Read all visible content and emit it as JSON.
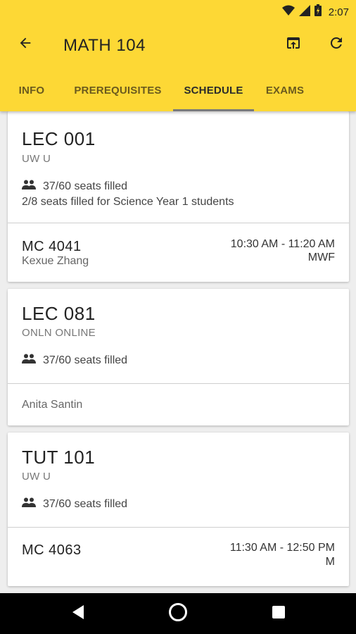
{
  "status_bar": {
    "time": "2:07",
    "icons": [
      "wifi-icon",
      "signal-icon",
      "battery-icon"
    ]
  },
  "toolbar": {
    "title": "MATH 104",
    "back_icon": "arrow-back-icon",
    "actions": [
      "open-in-browser-icon",
      "refresh-icon"
    ]
  },
  "tabs": [
    {
      "label": "INFO",
      "active": false
    },
    {
      "label": "PREREQUISITES",
      "active": false
    },
    {
      "label": "SCHEDULE",
      "active": true
    },
    {
      "label": "EXAMS",
      "active": false
    }
  ],
  "sections": [
    {
      "name": "LEC 001",
      "campus": "UW U",
      "seats": "37/60 seats filled",
      "reserve": "2/8 seats filled for Science Year 1 students",
      "room": "MC 4041",
      "instructor": "Kexue Zhang",
      "time": "10:30 AM - 11:20 AM",
      "days": "MWF"
    },
    {
      "name": "LEC 081",
      "campus": "ONLN ONLINE",
      "seats": "37/60 seats filled",
      "instructor": "Anita Santin"
    },
    {
      "name": "TUT 101",
      "campus": "UW U",
      "seats": "37/60 seats filled",
      "room": "MC 4063",
      "time": "11:30 AM - 12:50 PM",
      "days": "M"
    }
  ],
  "colors": {
    "app_bar": "#fdd835",
    "background": "#eeeeee",
    "card": "#ffffff",
    "nav_bar": "#000000"
  },
  "nav_bar": [
    "back-triangle-icon",
    "home-circle-icon",
    "recents-square-icon"
  ]
}
